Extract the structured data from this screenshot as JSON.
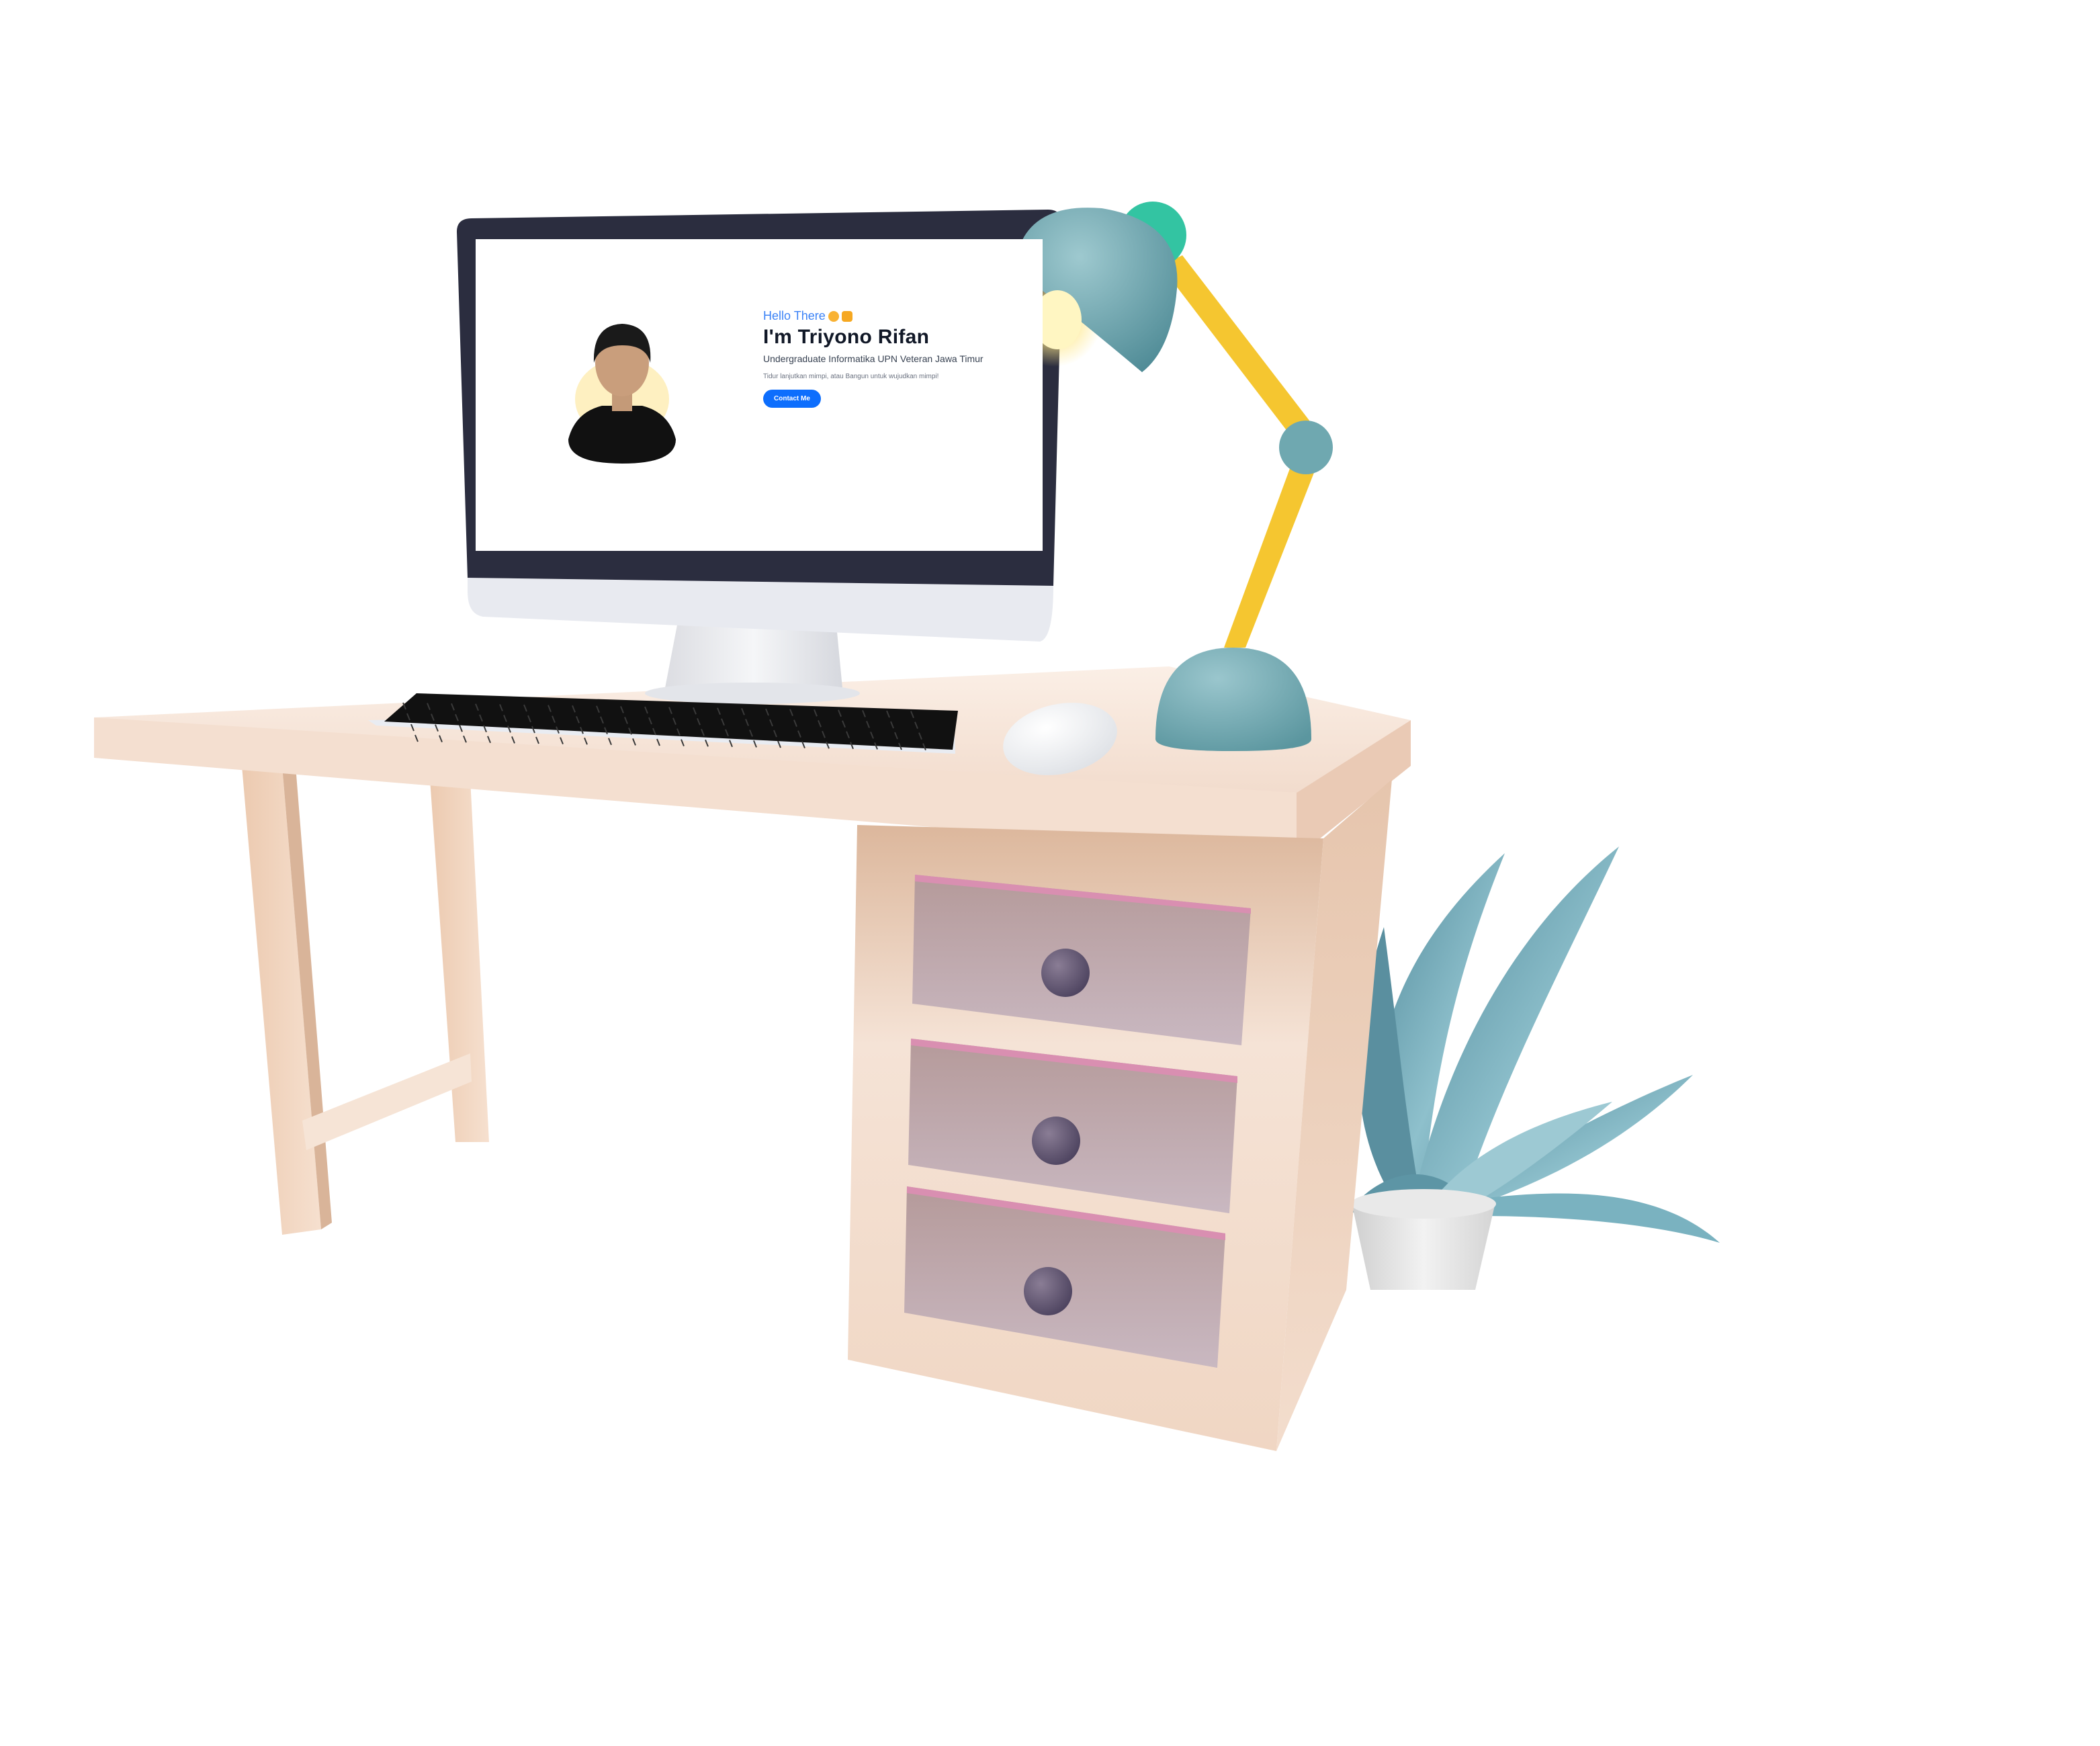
{
  "screen": {
    "greeting": "Hello There",
    "greeting_emojis": [
      "heart-eyes-emoji",
      "house-emoji"
    ],
    "name": "I'm Triyono Rifan",
    "subtitle": "Undergraduate Informatika UPN Veteran Jawa Timur",
    "quote": "Tidur lanjutkan mimpi, atau Bangun untuk wujudkan mimpi!",
    "contact_button": "Contact Me",
    "accent_color": "#3b82f6",
    "button_color": "#0d6efd"
  },
  "scene": {
    "objects": [
      "monitor",
      "keyboard",
      "mouse",
      "desk-lamp",
      "desk",
      "drawers",
      "potted-plant"
    ],
    "colors": {
      "desk": "#f3dccb",
      "drawer": "#c5b1b9",
      "lamp_shade": "#6fa8b0",
      "lamp_arm": "#f5c630",
      "plant": "#6ea2b2"
    }
  }
}
